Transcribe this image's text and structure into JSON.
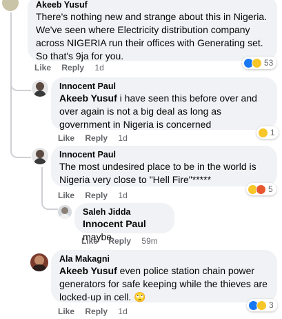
{
  "comments": [
    {
      "author": "Akeeb Yusuf",
      "text": "There's nothing new and strange about this in Nigeria. We've seen where Electricity distribution company across NIGERIA run their offices with Generating set. So that's 9ja for you.",
      "like": "Like",
      "reply": "Reply",
      "time": "1d",
      "reaction_count": "53",
      "reactions": [
        "like",
        "haha"
      ]
    },
    {
      "author": "Innocent Paul",
      "mention": "Akeeb Yusuf",
      "text": " i have seen this before over and over again is not a big deal as long as government in Nigeria is concerned",
      "like": "Like",
      "reply": "Reply",
      "time": "1d",
      "reaction_count": "1",
      "reactions": [
        "haha"
      ]
    },
    {
      "author": "Innocent Paul",
      "text": "The most undesired place to be in the world is Nigeria very close to \"Hell Fire\"*****",
      "like": "Like",
      "reply": "Reply",
      "time": "1d",
      "reaction_count": "5",
      "reactions": [
        "haha",
        "angry"
      ]
    },
    {
      "author": "Saleh Jidda",
      "mention": "Innocent Paul",
      "text": " maybe",
      "like": "Like",
      "reply": "Reply",
      "time": "59m"
    },
    {
      "author": "Ala Makagni",
      "mention": "Akeeb Yusuf",
      "text": " even police station chain power generators for safe keeping while the thieves are locked-up in cell. 🙄",
      "like": "Like",
      "reply": "Reply",
      "time": "1d",
      "reaction_count": "3",
      "reactions": [
        "like",
        "haha"
      ]
    }
  ],
  "colors": {
    "bubble": "#f0f2f5",
    "meta": "#65676b",
    "like": "#1877f2",
    "haha": "#f7c628",
    "angry": "#e8582e"
  }
}
